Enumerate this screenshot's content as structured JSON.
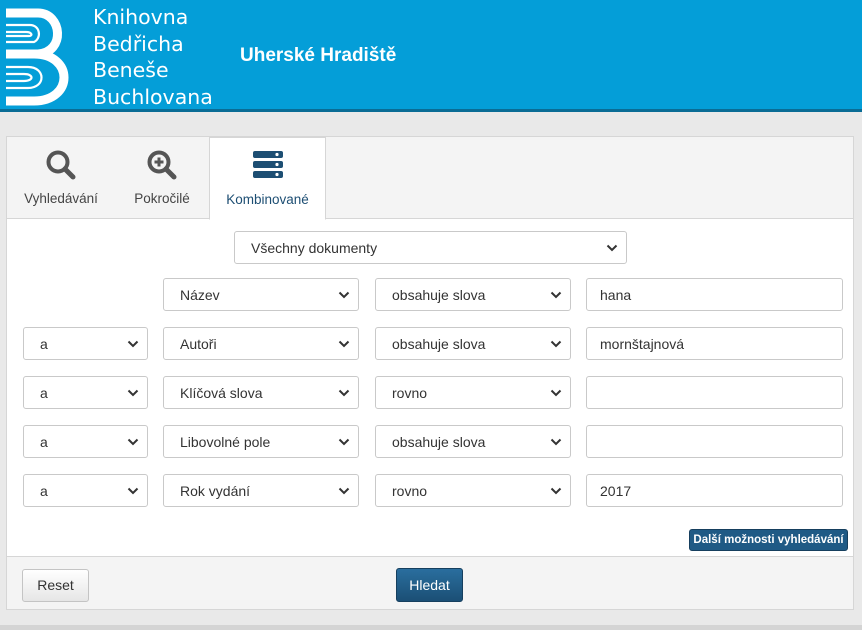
{
  "header": {
    "logo_lines": [
      "Knihovna",
      "Bedřicha",
      "Beneše",
      "Buchlovana"
    ],
    "city": "Uherské Hradiště",
    "colors": {
      "header_bg": "#049ed8",
      "header_border": "#0a6c95",
      "accent_dark": "#1f5a85"
    }
  },
  "tabs": [
    {
      "label": "Vyhledávání",
      "icon": "search-icon"
    },
    {
      "label": "Pokročilé",
      "icon": "zoom-plus-icon"
    },
    {
      "label": "Kombinované",
      "icon": "server-stack-icon",
      "active": true
    }
  ],
  "document_type": {
    "selected": "Všechny dokumenty"
  },
  "rows": [
    {
      "operator": "",
      "field": "Název",
      "condition": "obsahuje slova",
      "term": "hana"
    },
    {
      "operator": "a",
      "field": "Autoři",
      "condition": "obsahuje slova",
      "term": "mornštajnová"
    },
    {
      "operator": "a",
      "field": "Klíčová slova",
      "condition": "rovno",
      "term": ""
    },
    {
      "operator": "a",
      "field": "Libovolné pole",
      "condition": "obsahuje slova",
      "term": ""
    },
    {
      "operator": "a",
      "field": "Rok vydání",
      "condition": "rovno",
      "term": "2017"
    }
  ],
  "buttons": {
    "more_options": "Další možnosti vyhledávání",
    "reset": "Reset",
    "search": "Hledat"
  }
}
